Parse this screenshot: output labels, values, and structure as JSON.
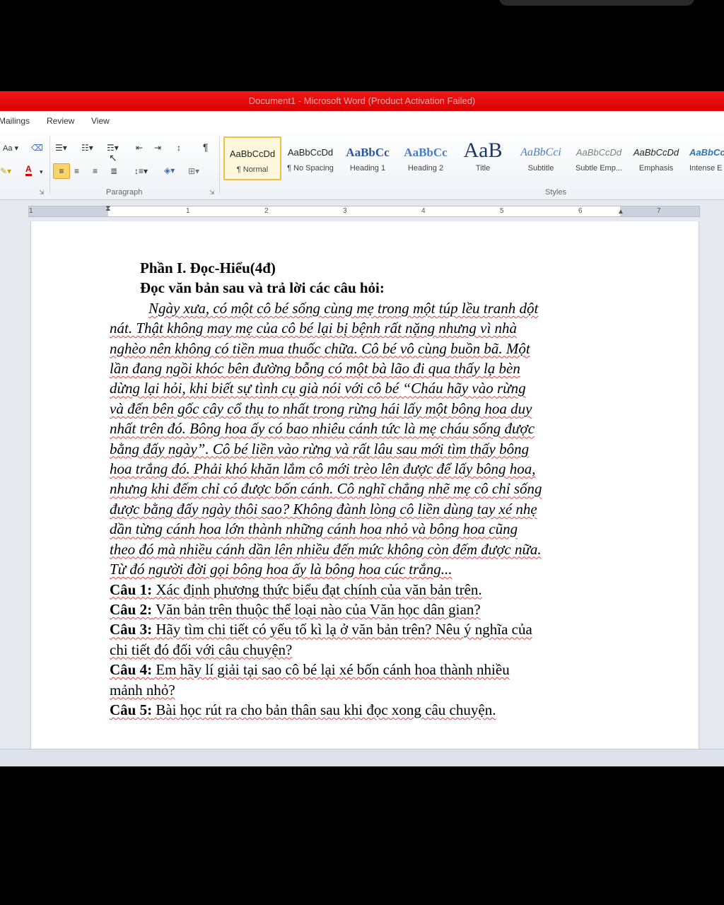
{
  "window": {
    "title": "Document1 - Microsoft Word (Product Activation Failed)"
  },
  "menu": {
    "mailings": "Mailings",
    "review": "Review",
    "view": "View"
  },
  "ribbon": {
    "font_size_label": "Aa",
    "pilcrow": "¶",
    "paragraph_group_label": "Paragraph",
    "styles_group_label": "Styles",
    "styles": [
      {
        "sample": "AaBbCcDd",
        "name": "¶ Normal"
      },
      {
        "sample": "AaBbCcDd",
        "name": "¶ No Spacing"
      },
      {
        "sample": "AaBbCc",
        "name": "Heading 1"
      },
      {
        "sample": "AaBbCc",
        "name": "Heading 2"
      },
      {
        "sample": "AaB",
        "name": "Title"
      },
      {
        "sample": "AaBbCci",
        "name": "Subtitle"
      },
      {
        "sample": "AaBbCcDd",
        "name": "Subtle Emp..."
      },
      {
        "sample": "AaBbCcDd",
        "name": "Emphasis"
      },
      {
        "sample": "AaBbCc",
        "name": "Intense E"
      }
    ]
  },
  "ruler": {
    "numbers": [
      "1",
      "1",
      "2",
      "3",
      "4",
      "5",
      "6",
      "7"
    ]
  },
  "document": {
    "heading": "Phần I. Đọc-Hiểu(4đ)",
    "instruction": "Đọc văn bản sau và trả lời các câu hỏi:",
    "story_lines": [
      "Ngày xưa, có một cô bé sống cùng mẹ trong một túp lều tranh dột",
      "nát. Thật không may mẹ của cô bé lại bị bệnh rất nặng nhưng vì nhà",
      "nghèo nên không có tiền mua thuốc chữa. Cô bé vô cùng buồn bã. Một",
      "lần đang ngồi khóc bên đường bỗng có một bà lão đi qua thấy lạ bèn",
      "dừng lại hỏi,  khi biết sự tình cụ già nói với cô bé “Cháu hãy vào rừng",
      "và đến bên gốc cây cổ thụ to nhất trong rừng hái lấy một bông hoa duy",
      "nhất trên đó. Bông hoa ấy có bao nhiêu cánh tức là mẹ cháu sống được",
      "bằng đấy ngày”. Cô bé liền vào rừng và rất lâu sau mới tìm thấy bông",
      "hoa trắng đó. Phải khó khăn lắm cô mới trèo lên được để lấy bông hoa,",
      "nhưng khi đếm chỉ có được bốn cánh. Cô nghĩ chẳng nhẽ mẹ cô chỉ sống",
      "được bằng đấy ngày thôi sao? Không đành lòng cô liền dùng tay xé nhẹ",
      "dần từng cánh hoa lớn thành những cánh hoa nhỏ và bông hoa cũng",
      "theo đó mà nhiều cánh dần lên nhiều đến mức không còn đếm được nữa.",
      "Từ đó người đời gọi bông hoa ấy là bông hoa cúc trắng..."
    ],
    "questions": [
      {
        "label": "Câu 1:",
        "lines": [
          " Xác định phương thức biểu đạt chính của văn bản trên."
        ]
      },
      {
        "label": "Câu 2:",
        "lines": [
          " Văn bản trên thuộc thể loại nào của Văn học dân gian?"
        ]
      },
      {
        "label": "Câu 3:",
        "lines": [
          " Hãy tìm chi tiết có yếu tố kì lạ ở văn bản trên? Nêu ý nghĩa của",
          "chi tiết đó  đối với câu chuyện?"
        ]
      },
      {
        "label": "Câu 4:",
        "lines": [
          " Em hãy lí giải tại sao cô bé lại xé bốn cánh hoa thành nhiều",
          "mảnh nhỏ?"
        ]
      },
      {
        "label": "Câu 5:",
        "lines": [
          " Bài học rút ra cho bản thân sau khi đọc xong câu chuyện."
        ]
      }
    ]
  }
}
